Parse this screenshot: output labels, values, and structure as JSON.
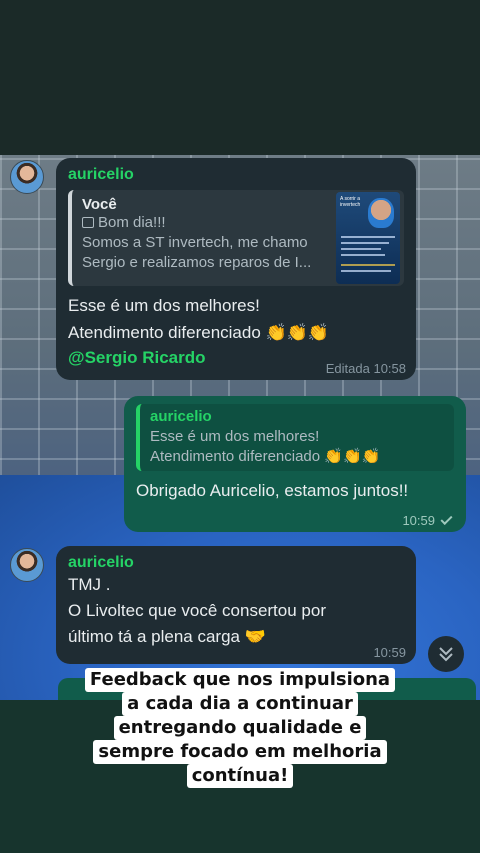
{
  "messages": {
    "m1": {
      "sender": "auricelio",
      "quote_author": "Você",
      "quote_line1_icon": "image-icon",
      "quote_line1": "Bom dia!!!",
      "quote_line2": "Somos a ST invertech, me chamo",
      "quote_line3": "Sergio e realizamos reparos de I...",
      "text_line1": "Esse é um dos melhores!",
      "text_line2": "Atendimento diferenciado 👏👏👏",
      "mention": "@Sergio Ricardo",
      "meta": "Editada 10:58"
    },
    "m2": {
      "quote_author": "auricelio",
      "quote_line1": "Esse é um dos melhores!",
      "quote_line2": "Atendimento diferenciado 👏👏👏",
      "text": "Obrigado Auricelio, estamos juntos!!",
      "time": "10:59",
      "status_icon": "single-check-icon"
    },
    "m3": {
      "sender": "auricelio",
      "text_line1": "TMJ .",
      "text_line2": "O Livoltec que você consertou por",
      "text_line3": "último tá a plena carga 🤝",
      "time": "10:59"
    }
  },
  "thumbnail": {
    "heading": "A sorrir a invertech"
  },
  "caption": {
    "line1": "Feedback que nos impulsiona",
    "line2": "a cada dia a continuar",
    "line3": "entregando qualidade e",
    "line4": "sempre focado em melhoria",
    "line5": "contínua!"
  },
  "colors": {
    "accent_green": "#25d366",
    "incoming_bubble": "#1f2c33",
    "outgoing_bubble": "#115c4b"
  }
}
